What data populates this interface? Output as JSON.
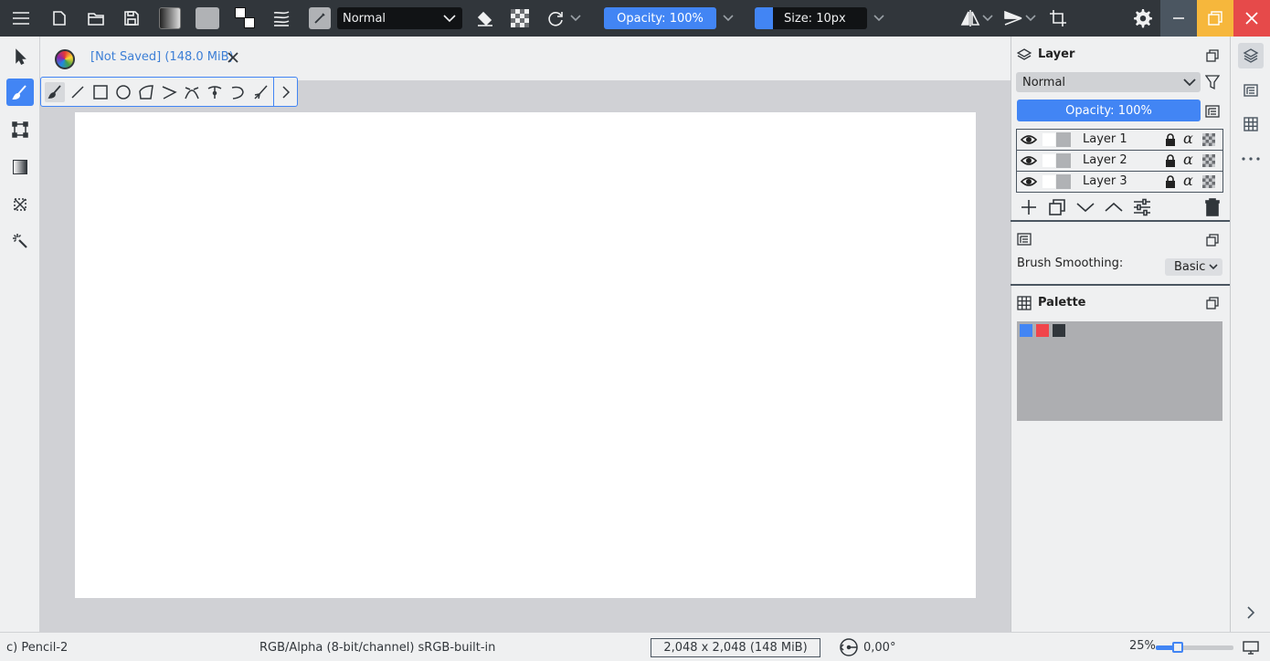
{
  "toolbar": {
    "blend_mode": "Normal",
    "opacity": "Opacity: 100%",
    "size": "Size: 10px",
    "brush_color": "#4285f4"
  },
  "document": {
    "title": "[Not Saved] (148.0 MiB)"
  },
  "layers_panel": {
    "title": "Layer",
    "blend_mode": "Normal",
    "opacity": "Opacity: 100%",
    "layers": [
      {
        "name": "Layer 1"
      },
      {
        "name": "Layer 2"
      },
      {
        "name": "Layer 3"
      }
    ]
  },
  "tool_options": {
    "brush_smoothing_label": "Brush Smoothing:",
    "brush_smoothing_value": "Basic"
  },
  "palette_panel": {
    "title": "Palette",
    "swatches": [
      "#4285f4",
      "#f0454b",
      "#31363b"
    ]
  },
  "status": {
    "brush": "c) Pencil-2",
    "color_space": "RGB/Alpha (8-bit/channel)  sRGB-built-in",
    "image_size": "2,048 x 2,048 (148 MiB)",
    "rotation": "0,00°",
    "zoom": "25%",
    "zoom_fraction": 0.25
  },
  "colors": {
    "accent": "#4285f4",
    "toolbar_bg": "#31363b",
    "close": "#e64a4a",
    "maximize": "#f6b73c"
  }
}
